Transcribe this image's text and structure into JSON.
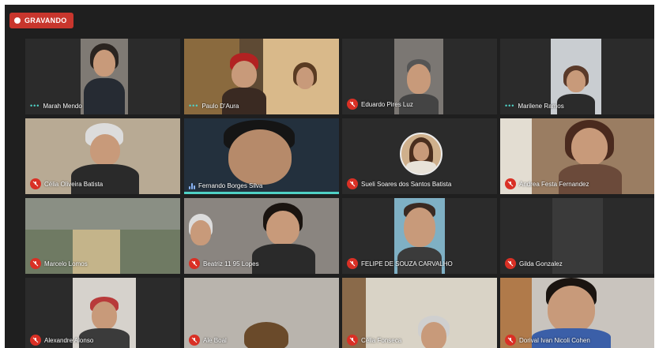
{
  "recording": {
    "label": "GRAVANDO"
  },
  "participants": [
    {
      "name": "Marah Mendo",
      "status": "dots"
    },
    {
      "name": "Paulo D'Aura",
      "status": "dots"
    },
    {
      "name": "Eduardo Pires Luz",
      "status": "muted"
    },
    {
      "name": "Marilene Ramos",
      "status": "dots"
    },
    {
      "name": "Célia Oliveira Batista",
      "status": "muted"
    },
    {
      "name": "Fernando Borges Silva",
      "status": "speaking"
    },
    {
      "name": "Sueli Soares dos Santos Batista",
      "status": "muted"
    },
    {
      "name": "Andrea Festa Fernandez",
      "status": "muted"
    },
    {
      "name": "Marcelo Lomos",
      "status": "muted"
    },
    {
      "name": "Beatriz 11 95 Lopes",
      "status": "muted"
    },
    {
      "name": "FELIPE DE SOUZA CARVALHO",
      "status": "muted"
    },
    {
      "name": "Gilda Gonzalez",
      "status": "muted"
    },
    {
      "name": "Alexandre Alonso",
      "status": "muted"
    },
    {
      "name": "Ale Boal",
      "status": "muted"
    },
    {
      "name": "Célia Fonseca",
      "status": "muted"
    },
    {
      "name": "Dorival Ivan Nicoli Cohen",
      "status": "muted"
    }
  ],
  "colors": {
    "record_badge": "#c8362d",
    "mute": "#d93025",
    "speaking_border": "#4fd1c5",
    "background": "#1f1f1f"
  }
}
